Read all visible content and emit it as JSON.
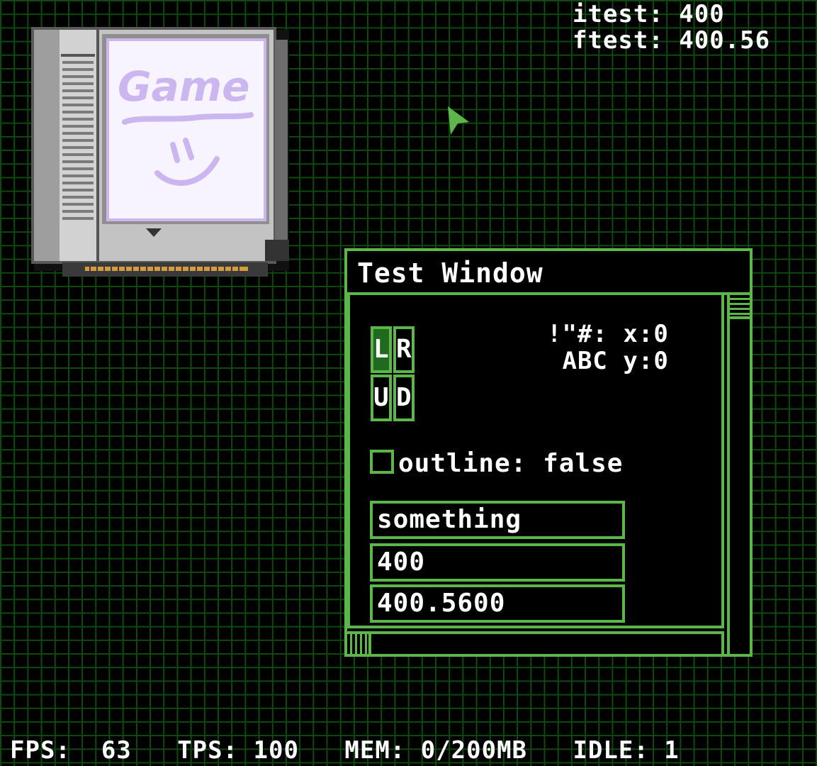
{
  "debug": {
    "itest": "itest: 400",
    "ftest": "ftest: 400.56"
  },
  "cartridge": {
    "label_text": "Game"
  },
  "window": {
    "title": "Test Window",
    "dpad": {
      "left": "L",
      "right": "R",
      "up": "U",
      "down": "D",
      "active": "left"
    },
    "symbols_line1": "!\"#:",
    "symbols_line2": "ABC",
    "coord_x": "x:0",
    "coord_y": "y:0",
    "checkbox": {
      "label": "outline: false",
      "checked": false
    },
    "fields": {
      "text": "something",
      "int": "400",
      "float": "400.5600"
    }
  },
  "status_bar": {
    "fps": "FPS:  63",
    "tps": "TPS: 100",
    "mem": "MEM: 0/200MB",
    "idle": "IDLE: 1"
  },
  "colors": {
    "accent": "#5db64a",
    "grid": "#0f4a0f",
    "active_button": "#1e6a1e"
  }
}
